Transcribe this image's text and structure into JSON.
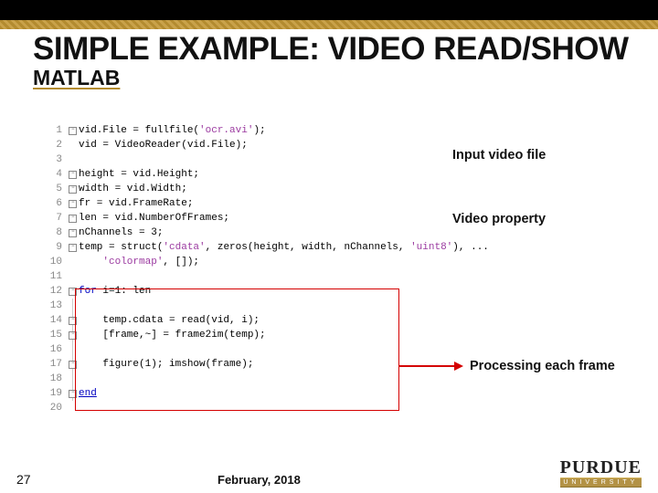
{
  "header": {
    "title": "SIMPLE EXAMPLE: VIDEO READ/SHOW",
    "subtitle": "MATLAB"
  },
  "code": {
    "lines": [
      {
        "n": 1,
        "fold": "minus",
        "idx": 0
      },
      {
        "n": 2,
        "fold": "",
        "idx": 1
      },
      {
        "n": 3,
        "fold": "",
        "idx": 2
      },
      {
        "n": 4,
        "fold": "minus",
        "idx": 3
      },
      {
        "n": 5,
        "fold": "minus",
        "idx": 4
      },
      {
        "n": 6,
        "fold": "minus",
        "idx": 5
      },
      {
        "n": 7,
        "fold": "minus",
        "idx": 6
      },
      {
        "n": 8,
        "fold": "minus",
        "idx": 7
      },
      {
        "n": 9,
        "fold": "minus",
        "idx": 8
      },
      {
        "n": 10,
        "fold": "",
        "idx": 9
      },
      {
        "n": 11,
        "fold": "",
        "idx": 10
      },
      {
        "n": 12,
        "fold": "minus",
        "idx": 11
      },
      {
        "n": 13,
        "fold": "",
        "idx": 12
      },
      {
        "n": 14,
        "fold": "minus",
        "idx": 13
      },
      {
        "n": 15,
        "fold": "minus",
        "idx": 14
      },
      {
        "n": 16,
        "fold": "",
        "idx": 15
      },
      {
        "n": 17,
        "fold": "minus",
        "idx": 16
      },
      {
        "n": 18,
        "fold": "",
        "idx": 17
      },
      {
        "n": 19,
        "fold": "minus",
        "idx": 18
      },
      {
        "n": 20,
        "fold": "",
        "idx": 19
      }
    ],
    "text": [
      {
        "t": "vid.File = fullfile(",
        "s": "'ocr.avi'",
        "r": ");"
      },
      {
        "t": "vid = VideoReader(vid.File);"
      },
      {
        "t": ""
      },
      {
        "t": "height = vid.Height;"
      },
      {
        "t": "width = vid.Width;"
      },
      {
        "t": "fr = vid.FrameRate;"
      },
      {
        "t": "len = vid.NumberOfFrames;"
      },
      {
        "t": "nChannels = 3;"
      },
      {
        "t": "temp = struct(",
        "s": "'cdata'",
        "r": ", zeros(height, width, nChannels, ",
        "s2": "'uint8'",
        "r2": "), ..."
      },
      {
        "t": "    ",
        "s": "'colormap'",
        "r": ", []);"
      },
      {
        "t": ""
      },
      {
        "kw": "for",
        "t": " i=1: len"
      },
      {
        "t": ""
      },
      {
        "t": "    temp.cdata = read(vid, i);"
      },
      {
        "t": "    [frame,~] = frame2im(temp);"
      },
      {
        "t": ""
      },
      {
        "t": "    figure(1); imshow(frame);"
      },
      {
        "t": ""
      },
      {
        "kwend": "end"
      },
      {
        "t": ""
      }
    ]
  },
  "annotations": {
    "input": "Input video file",
    "property": "Video property",
    "processing": "Processing each frame"
  },
  "footer": {
    "page": "27",
    "date": "February, 2018",
    "logo_top": "PURDUE",
    "logo_bottom": "UNIVERSITY"
  }
}
